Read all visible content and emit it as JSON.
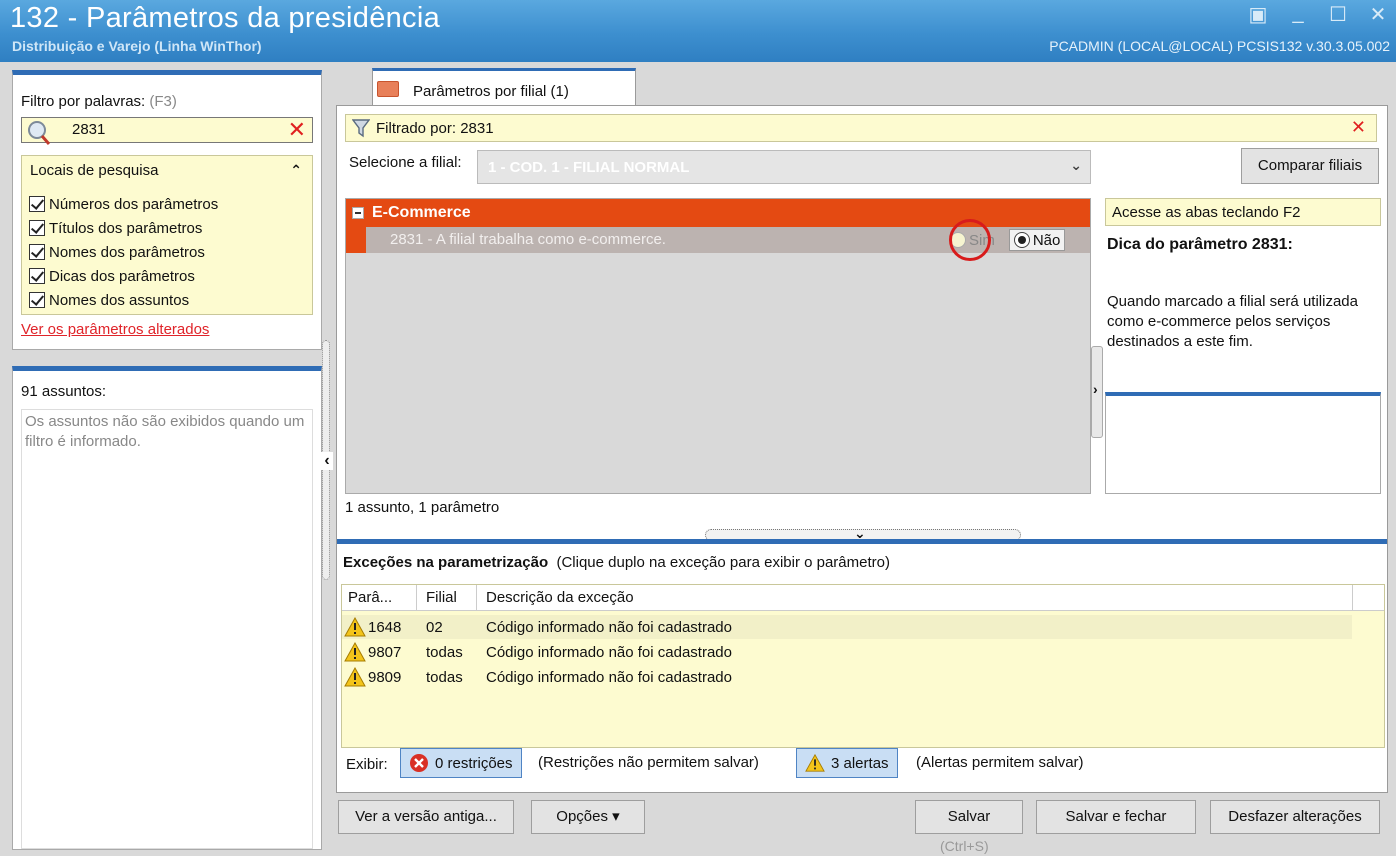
{
  "window": {
    "title": "132 - Parâmetros da presidência",
    "subtitle": "Distribuição e Varejo (Linha WinThor)",
    "userinfo": "PCADMIN (LOCAL@LOCAL)  PCSIS132  v.30.3.05.002"
  },
  "filter": {
    "label": "Filtro por palavras:",
    "shortcut": "(F3)",
    "value": "2831",
    "locais_title": "Locais de pesquisa",
    "options": [
      {
        "label": "Números dos parâmetros",
        "checked": true
      },
      {
        "label": "Títulos dos parâmetros",
        "checked": true
      },
      {
        "label": "Nomes dos parâmetros",
        "checked": true
      },
      {
        "label": "Dicas dos parâmetros",
        "checked": true
      },
      {
        "label": "Nomes dos assuntos",
        "checked": true
      }
    ],
    "changed_link": "Ver os parâmetros alterados"
  },
  "subjects": {
    "count_label": "91 assuntos:",
    "message": "Os assuntos não são exibidos quando um filtro é informado."
  },
  "tab": {
    "label": "Parâmetros por filial  (1)"
  },
  "filtered": {
    "label": "Filtrado por: 2831"
  },
  "branch": {
    "label": "Selecione a filial:",
    "value": "1 - COD. 1 - FILIAL NORMAL",
    "compare_button": "Comparar filiais"
  },
  "params": {
    "category": "E-Commerce",
    "row_text": "2831 - A filial trabalha como e-commerce.",
    "option_yes": "Sim",
    "option_no": "Não",
    "selected": "Não",
    "summary": "1 assunto, 1 parâmetro"
  },
  "tip": {
    "hint": "Acesse as abas teclando F2",
    "title": "Dica do parâmetro 2831:",
    "body": "Quando marcado a filial será utilizada como e-commerce pelos serviços destinados a este fim."
  },
  "exceptions": {
    "title": "Exceções na parametrização",
    "subtitle": "(Clique duplo na exceção para exibir o parâmetro)",
    "columns": [
      "Parâ...",
      "Filial",
      "Descrição da exceção"
    ],
    "rows": [
      {
        "param": "1648",
        "filial": "02",
        "desc": "Código informado não foi cadastrado"
      },
      {
        "param": "9807",
        "filial": "todas",
        "desc": "Código informado não foi cadastrado"
      },
      {
        "param": "9809",
        "filial": "todas",
        "desc": "Código informado não foi cadastrado"
      }
    ]
  },
  "display": {
    "label": "Exibir:",
    "restrictions_button": "0 restrições",
    "restrictions_note": "(Restrições não permitem salvar)",
    "alerts_button": "3 alertas",
    "alerts_note": "(Alertas permitem salvar)"
  },
  "buttons": {
    "old_version": "Ver a versão antiga...",
    "options": "Opções ▾",
    "save": "Salvar",
    "save_shortcut": "(Ctrl+S)",
    "save_close": "Salvar e fechar",
    "undo": "Desfazer alterações"
  },
  "colors": {
    "accent": "#2f6cb5",
    "category": "#e44a12",
    "highlight": "#d81b1b",
    "yellow_bg": "#fdfbd0"
  }
}
